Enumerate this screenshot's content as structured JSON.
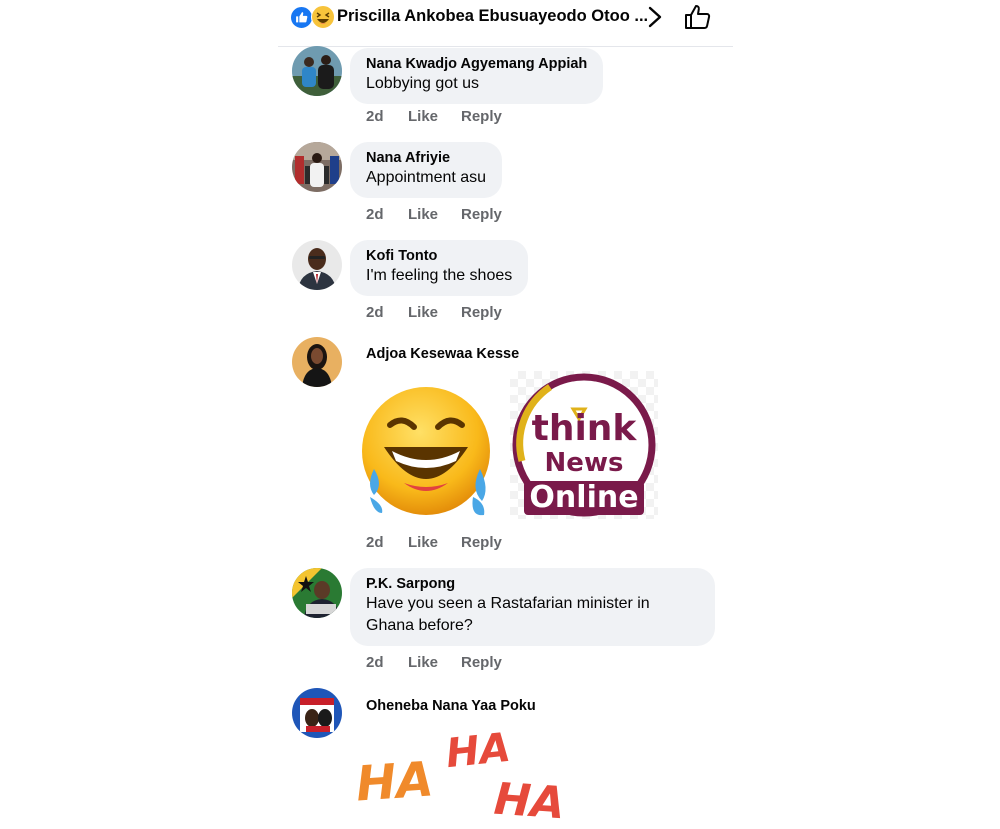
{
  "header": {
    "title": "Priscilla Ankobea Ebusuayeodo Otoo ...",
    "reaction_icons": [
      "like-reaction-icon",
      "haha-reaction-icon"
    ],
    "accent": "#1877f2"
  },
  "actions": {
    "like_label": "Like",
    "reply_label": "Reply"
  },
  "comments": [
    {
      "name": "Nana Kwadjo Agyemang Appiah",
      "text": "Lobbying got us",
      "time": "2d"
    },
    {
      "name": "Nana Afriyie",
      "text": "Appointment asu",
      "time": "2d"
    },
    {
      "name": "Kofi Tonto",
      "text": "I'm feeling the shoes",
      "time": "2d"
    },
    {
      "name": "Adjoa Kesewaa Kesse",
      "text": "",
      "time": "2d",
      "sticker": {
        "line1": "think",
        "line2": "News",
        "line3": "Online"
      }
    },
    {
      "name": "P.K. Sarpong",
      "text_line1": "Have you seen a Rastafarian minister in",
      "text_line2": "Ghana before?",
      "time": "2d"
    },
    {
      "name": "Oheneba Nana Yaa Poku",
      "sticker_words": [
        "HA",
        "HA",
        "HA"
      ]
    }
  ]
}
